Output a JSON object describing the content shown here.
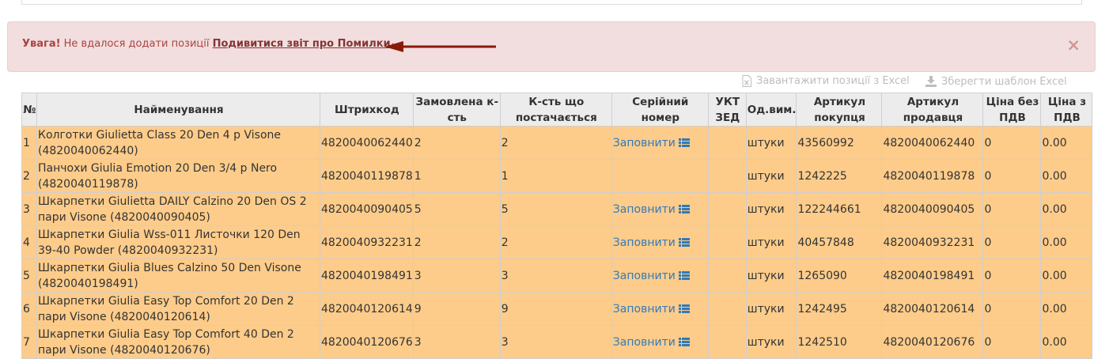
{
  "alert": {
    "strong": "Увага!",
    "message": "Не вдалося додати позиції",
    "link": "Подивитися звіт про Помилки",
    "close": "×"
  },
  "excel": {
    "upload": "Завантажити позиції з Excel",
    "save": "Зберегти шаблон Excel"
  },
  "table": {
    "headers": [
      "№",
      "Найменування",
      "Штрихкод",
      "Замовлена к-сть",
      "К-сть що постачається",
      "Серійний номер",
      "УКТ ЗЕД",
      "Од.вим.",
      "Артикул покупця",
      "Артикул продавця",
      "Ціна без ПДВ",
      "Ціна з ПДВ"
    ],
    "fill_label": "Заповнити",
    "rows": [
      {
        "num": "1",
        "name": "Колготки Giulietta Class 20 Den 4 р Visone (4820040062440)",
        "barcode": "4820040062440",
        "ordered": "2",
        "supplied": "2",
        "serial": "Заповнити",
        "ukt": "",
        "unit": "штуки",
        "buyer_sku": "43560992",
        "seller_sku": "4820040062440",
        "price_net": "0",
        "price_gross": "0.00"
      },
      {
        "num": "2",
        "name": "Панчохи Giulia Emotion 20 Den 3/4 р Nero (4820040119878)",
        "barcode": "4820040119878",
        "ordered": "1",
        "supplied": "1",
        "serial": "",
        "ukt": "",
        "unit": "штуки",
        "buyer_sku": "1242225",
        "seller_sku": "4820040119878",
        "price_net": "0",
        "price_gross": "0.00"
      },
      {
        "num": "3",
        "name": "Шкарпетки Giulietta DAILY Calzino 20 Den OS 2 пари Visone (4820040090405)",
        "barcode": "4820040090405",
        "ordered": "5",
        "supplied": "5",
        "serial": "Заповнити",
        "ukt": "",
        "unit": "штуки",
        "buyer_sku": "122244661",
        "seller_sku": "4820040090405",
        "price_net": "0",
        "price_gross": "0.00"
      },
      {
        "num": "4",
        "name": "Шкарпетки Giulia Wss-011 Листочки 120 Den 39-40 Powder (4820040932231)",
        "barcode": "4820040932231",
        "ordered": "2",
        "supplied": "2",
        "serial": "Заповнити",
        "ukt": "",
        "unit": "штуки",
        "buyer_sku": "40457848",
        "seller_sku": "4820040932231",
        "price_net": "0",
        "price_gross": "0.00"
      },
      {
        "num": "5",
        "name": "Шкарпетки Giulia Blues Calzino 50 Den Visone (4820040198491)",
        "barcode": "4820040198491",
        "ordered": "3",
        "supplied": "3",
        "serial": "Заповнити",
        "ukt": "",
        "unit": "штуки",
        "buyer_sku": "1265090",
        "seller_sku": "4820040198491",
        "price_net": "0",
        "price_gross": "0.00"
      },
      {
        "num": "6",
        "name": "Шкарпетки Giulia Easy Top Comfort 20 Den 2 пари Visone (4820040120614)",
        "barcode": "4820040120614",
        "ordered": "9",
        "supplied": "9",
        "serial": "Заповнити",
        "ukt": "",
        "unit": "штуки",
        "buyer_sku": "1242495",
        "seller_sku": "4820040120614",
        "price_net": "0",
        "price_gross": "0.00"
      },
      {
        "num": "7",
        "name": "Шкарпетки Giulia Easy Top Comfort 40 Den 2 пари Visone (4820040120676)",
        "barcode": "4820040120676",
        "ordered": "3",
        "supplied": "3",
        "serial": "Заповнити",
        "ukt": "",
        "unit": "штуки",
        "buyer_sku": "1242510",
        "seller_sku": "4820040120676",
        "price_net": "0",
        "price_gross": "0.00"
      }
    ]
  },
  "colors": {
    "alert_bg": "#f2dede",
    "alert_text": "#a94442",
    "arrow": "#8b1a0a",
    "row_bg": "#fdcc8a",
    "header_bg": "#ececec",
    "link": "#337ab7"
  }
}
